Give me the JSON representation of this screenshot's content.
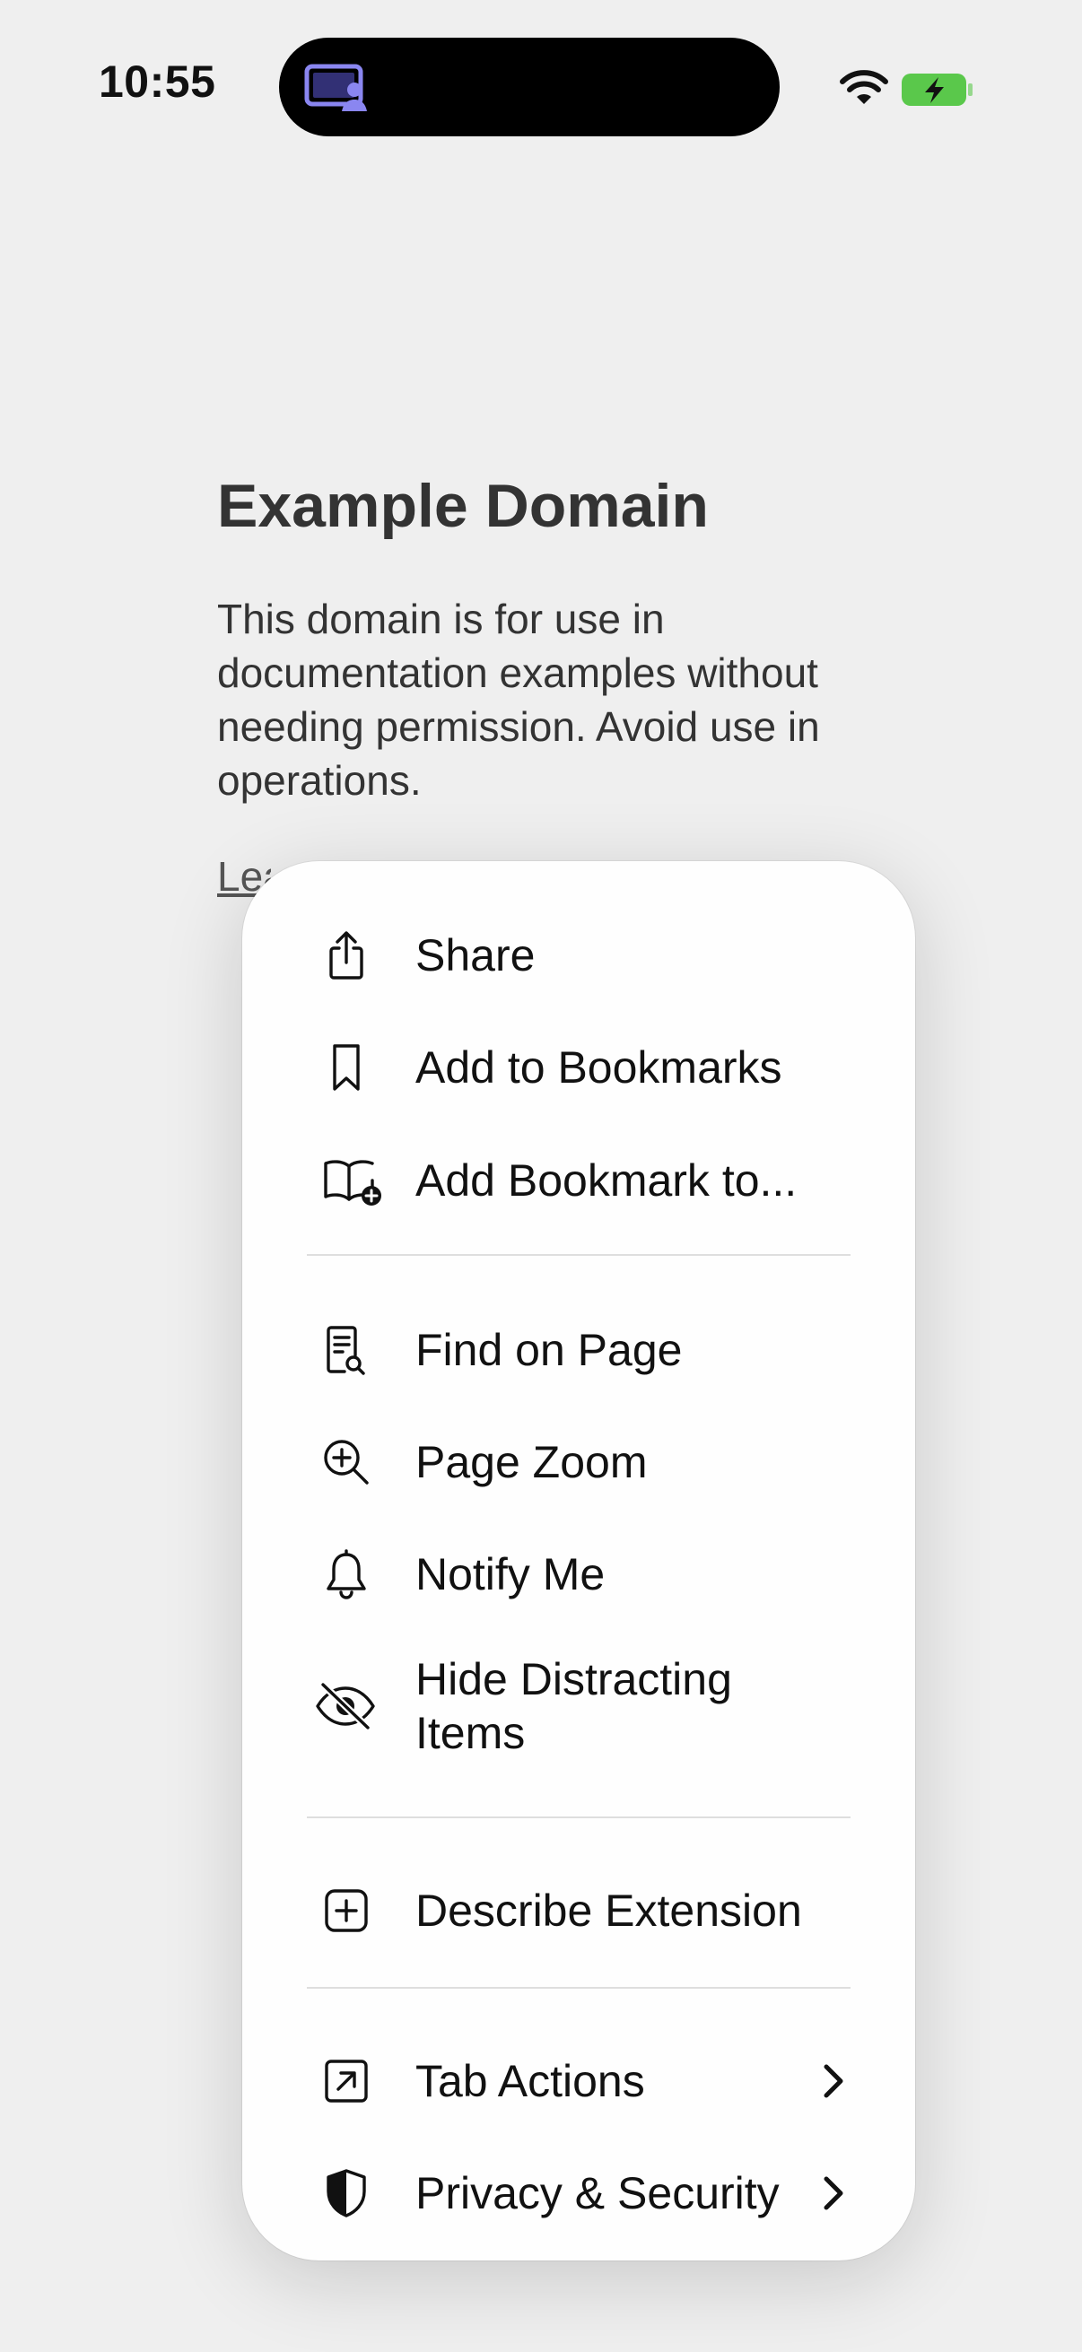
{
  "status_bar": {
    "time": "10:55",
    "island_icon": "screen-share-person-icon",
    "wifi_icon": "wifi-icon",
    "battery_icon": "battery-charging-icon",
    "battery_color": "#5ac84b"
  },
  "page": {
    "title": "Example Domain",
    "body": "This domain is for use in documentation examples without needing permission. Avoid use in operations.",
    "link_partial": "Lea"
  },
  "menu": {
    "share": {
      "label": "Share",
      "icon": "share-icon"
    },
    "add_bookmarks": {
      "label": "Add to Bookmarks",
      "icon": "bookmark-icon"
    },
    "add_bookmark_to": {
      "label": "Add Bookmark to...",
      "icon": "book-plus-icon"
    },
    "find_on_page": {
      "label": "Find on Page",
      "icon": "find-document-icon"
    },
    "page_zoom": {
      "label": "Page Zoom",
      "icon": "zoom-in-icon"
    },
    "notify_me": {
      "label": "Notify Me",
      "icon": "bell-icon"
    },
    "hide_distracting": {
      "label_line1": "Hide Distracting",
      "label_line2": "Items",
      "icon": "eye-slash-icon"
    },
    "describe_extension": {
      "label": "Describe Extension",
      "icon": "plus-square-icon"
    },
    "tab_actions": {
      "label": "Tab Actions",
      "icon": "arrow-up-right-square-icon"
    },
    "privacy_security": {
      "label": "Privacy & Security",
      "icon": "shield-half-icon"
    }
  }
}
